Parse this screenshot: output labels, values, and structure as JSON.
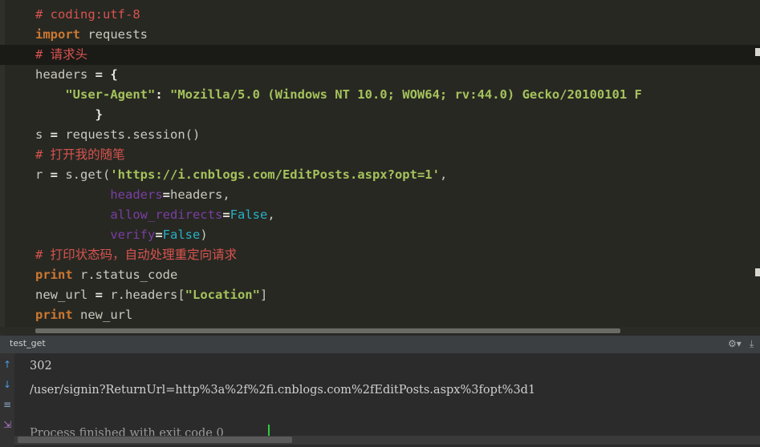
{
  "editor": {
    "lines": [
      {
        "parts": [
          {
            "c": "cmt",
            "t": "# coding:utf-8"
          }
        ]
      },
      {
        "parts": [
          {
            "c": "kw",
            "t": "import"
          },
          {
            "c": "plain",
            "t": " requests"
          }
        ]
      },
      {
        "current": true,
        "parts": [
          {
            "c": "cmt",
            "t": "# 请求头"
          }
        ]
      },
      {
        "parts": [
          {
            "c": "plain",
            "t": "headers "
          },
          {
            "c": "",
            "t": "= {"
          }
        ]
      },
      {
        "parts": [
          {
            "c": "plain",
            "t": "    "
          },
          {
            "c": "str",
            "t": "\"User-Agent\""
          },
          {
            "c": "",
            "t": ": "
          },
          {
            "c": "str",
            "t": "\"Mozilla/5.0 (Windows NT 10.0; WOW64; rv:44.0) Gecko/20100101 F"
          }
        ]
      },
      {
        "parts": [
          {
            "c": "plain",
            "t": "        "
          },
          {
            "c": "",
            "t": "}"
          }
        ]
      },
      {
        "parts": [
          {
            "c": "plain",
            "t": "s "
          },
          {
            "c": "",
            "t": "= "
          },
          {
            "c": "plain",
            "t": "requests.session()"
          }
        ]
      },
      {
        "parts": [
          {
            "c": "cmt",
            "t": "# 打开我的随笔"
          }
        ]
      },
      {
        "parts": [
          {
            "c": "plain",
            "t": "r "
          },
          {
            "c": "",
            "t": "= "
          },
          {
            "c": "plain",
            "t": "s.get("
          },
          {
            "c": "str",
            "t": "'https://i.cnblogs.com/EditPosts.aspx?opt=1'"
          },
          {
            "c": "plain",
            "t": ","
          }
        ]
      },
      {
        "parts": [
          {
            "c": "plain",
            "t": "          "
          },
          {
            "c": "kwarg",
            "t": "headers"
          },
          {
            "c": "",
            "t": "="
          },
          {
            "c": "plain",
            "t": "headers,"
          }
        ]
      },
      {
        "parts": [
          {
            "c": "plain",
            "t": "          "
          },
          {
            "c": "kwarg",
            "t": "allow_redirects"
          },
          {
            "c": "",
            "t": "="
          },
          {
            "c": "const",
            "t": "False"
          },
          {
            "c": "plain",
            "t": ","
          }
        ]
      },
      {
        "parts": [
          {
            "c": "plain",
            "t": "          "
          },
          {
            "c": "kwarg",
            "t": "verify"
          },
          {
            "c": "",
            "t": "="
          },
          {
            "c": "const",
            "t": "False"
          },
          {
            "c": "plain",
            "t": ")"
          }
        ]
      },
      {
        "parts": [
          {
            "c": "cmt",
            "t": "# 打印状态码，自动处理重定向请求"
          }
        ]
      },
      {
        "parts": [
          {
            "c": "kw",
            "t": "print"
          },
          {
            "c": "plain",
            "t": " r.status_code"
          }
        ]
      },
      {
        "parts": [
          {
            "c": "plain",
            "t": "new_url "
          },
          {
            "c": "",
            "t": "= "
          },
          {
            "c": "plain",
            "t": "r.headers["
          },
          {
            "c": "str",
            "t": "\"Location\""
          },
          {
            "c": "plain",
            "t": "]"
          }
        ]
      },
      {
        "parts": [
          {
            "c": "kw",
            "t": "print"
          },
          {
            "c": "plain",
            "t": " new_url"
          }
        ]
      }
    ]
  },
  "run_panel": {
    "title": "test_get",
    "settings_icon": "gear-icon",
    "hide_icon": "hide-panel-icon"
  },
  "console": {
    "lines": [
      "302",
      "/user/signin?ReturnUrl=http%3a%2f%2fi.cnblogs.com%2fEditPosts.aspx%3fopt%3d1",
      "",
      "Process finished with exit code 0"
    ],
    "side_icons": [
      "rerun-up-icon",
      "rerun-down-icon",
      "wrap-icon",
      "scroll-end-icon"
    ]
  }
}
